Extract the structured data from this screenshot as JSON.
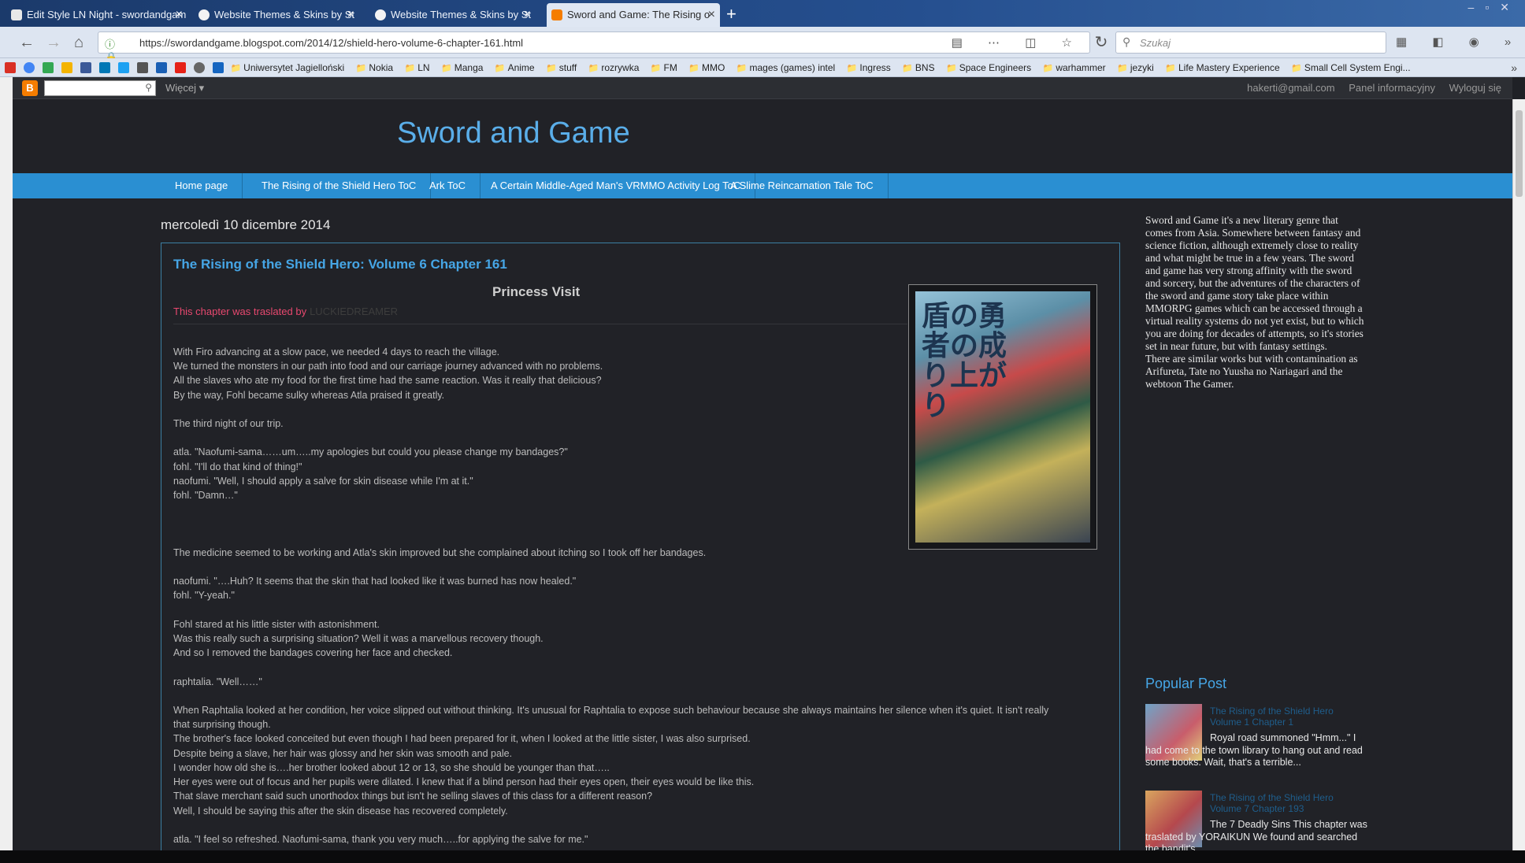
{
  "tabs": [
    {
      "label": "Edit Style LN Night - swordandgam",
      "close": "×"
    },
    {
      "label": "Website Themes & Skins by St",
      "close": "×"
    },
    {
      "label": "Website Themes & Skins by St",
      "close": "×"
    },
    {
      "label": "Sword and Game: The Rising o",
      "close": "×"
    }
  ],
  "new_tab": "+",
  "url": "https://swordandgame.blogspot.com/2014/12/shield-hero-volume-6-chapter-161.html",
  "search_placeholder": "Szukaj",
  "bookmarks": [
    "Uniwersytet Jagielloński",
    "Nokia",
    "LN",
    "Manga",
    "Anime",
    "stuff",
    "rozrywka",
    "FM",
    "MMO",
    "mages (games) intel",
    "Ingress",
    "BNS",
    "Space Engineers",
    "warhammer",
    "jezyki",
    "Life Mastery Experience",
    "Small Cell System Engi..."
  ],
  "blogger": {
    "more": "Więcej ▾",
    "email": "hakerti@gmail.com",
    "dashboard": "Panel informacyjny",
    "logout": "Wyloguj się"
  },
  "site_title": "Sword and Game",
  "menu": [
    "Home page",
    "The Rising of the Shield Hero ToC",
    "Ark ToC",
    "A Certain Middle-Aged Man's VRMMO Activity Log ToC",
    "A Slime Reincarnation Tale ToC"
  ],
  "date": "mercoledì 10 dicembre 2014",
  "post": {
    "title": "The Rising of the Shield Hero: Volume 6 Chapter 161",
    "chapter_name": "Princess Visit",
    "translated_by": "This chapter was traslated by",
    "translator": "LUCKIEDREAMER",
    "cover_text": "盾の勇者の成り上がり",
    "paragraphs": [
      "With Firo advancing at a slow pace, we needed 4 days to reach the village.\nWe turned the monsters in our path into food and our carriage journey advanced with no problems.\nAll the slaves who ate my food for the first time had the same reaction. Was it really that delicious?\nBy the way, Fohl became sulky whereas Atla praised it greatly.",
      "The third night of our trip.",
      "atla. \"Naofumi-sama……um…..my apologies but could you please change my bandages?\"\nfohl. \"I'll do that kind of thing!\"\nnaofumi. \"Well, I should apply a salve for skin disease while I'm at it.\"\nfohl. \"Damn…\"",
      "\n",
      "The medicine seemed to be working and Atla's skin improved but she complained about itching so I took off her bandages.",
      "naofumi. \"….Huh? It seems that the skin that had looked like it was burned has now healed.\"\nfohl. \"Y-yeah.\"",
      "Fohl stared at his little sister with astonishment.\nWas this really such a surprising situation? Well it was a marvellous recovery though.\nAnd so I removed the bandages covering her face and checked.",
      "raphtalia. \"Well……\"",
      "When Raphtalia looked at her condition, her voice slipped out without thinking. It's unusual for Raphtalia to expose such behaviour because she always maintains her silence when it's quiet. It isn't really\nthat surprising though.\nThe brother's face looked conceited but even though I had been prepared for it, when I looked at the little sister, I was also surprised.\nDespite being a slave, her hair was glossy and her skin was smooth and pale.\nI wonder how old she is….her brother looked about 12 or 13, so she should be younger than that…..\nHer eyes were out of focus and her pupils were dilated. I knew that if a blind person had their eyes open, their eyes would be like this.\nThat slave merchant said such unorthodox things but isn't he selling slaves of this class for a different reason?\nWell, I should be saying this after the skin disease has recovered completely.",
      "atla. \"I feel so refreshed. Naofumi-sama, thank you very much…..for applying the salve for me.\""
    ]
  },
  "sidebar": {
    "description": "Sword and Game it's a new literary genre that comes from Asia. Somewhere between fantasy and science fiction, although extremely close to reality and what might be true in a few years. The sword and game has very strong affinity with the sword and sorcery, but the adventures of the characters of the sword and game story take place within MMORPG games which can be accessed through a virtual reality systems do not yet exist, but to which you are doing for decades of attempts, so it's stories set in near future, but with fantasy settings.\nThere are similar works but with contamination as Arifureta, Tate no Yuusha no Nariagari and the webtoon The Gamer.",
    "popular_title": "Popular Post",
    "popular": [
      {
        "link": "The Rising of the Shield Hero Volume 1 Chapter 1",
        "snippet": "Royal road summoned \"Hmm...\" I had come to the town library to hang out and read some books. Wait, that's a terrible..."
      },
      {
        "link": "The Rising of the Shield Hero Volume 7 Chapter 193",
        "snippet": "The 7 Deadly Sins This chapter was traslated by YORAIKUN We found and searched the bandit's"
      }
    ]
  },
  "colors": {
    "accent": "#2a8fd2",
    "title": "#5aaee9",
    "link": "#46a6e6",
    "translator_label": "#e8486f"
  }
}
